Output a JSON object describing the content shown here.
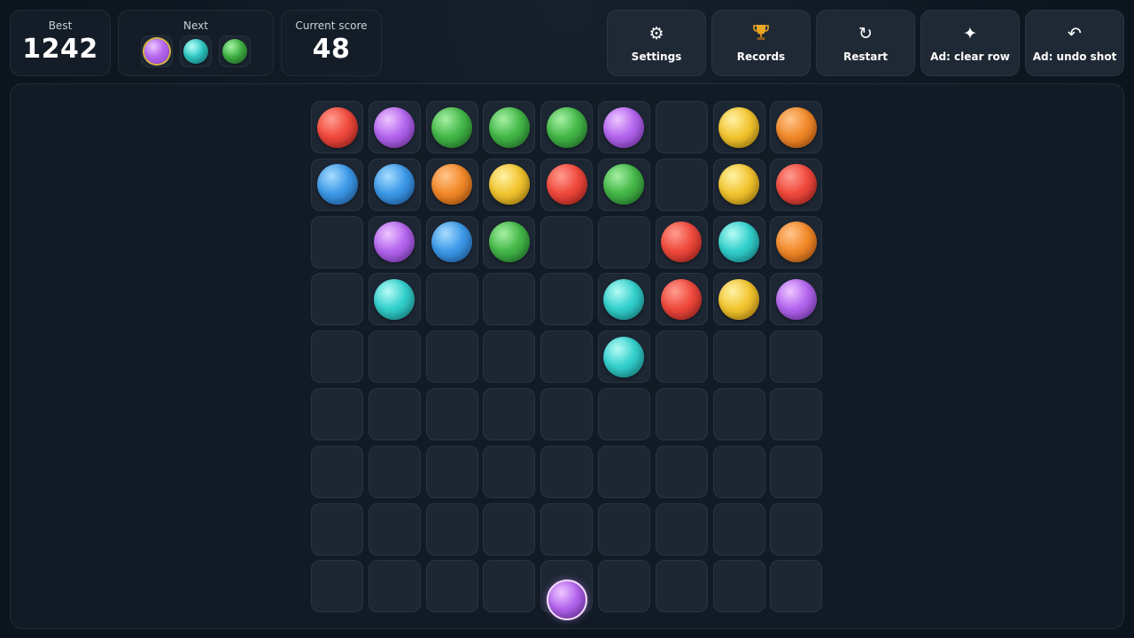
{
  "stats": {
    "best": {
      "label": "Best",
      "value": "1242"
    },
    "next": {
      "label": "Next",
      "balls": [
        "purple",
        "cyan",
        "green"
      ]
    },
    "score": {
      "label": "Current score",
      "value": "48"
    }
  },
  "toolbar": {
    "settings": {
      "label": "Settings",
      "icon": "gear-icon"
    },
    "records": {
      "label": "Records",
      "icon": "trophy-icon"
    },
    "restart": {
      "label": "Restart",
      "icon": "restart-icon"
    },
    "clear_row": {
      "label": "Ad: clear row",
      "icon": "sparkle-icon"
    },
    "undo_shot": {
      "label": "Ad: undo shot",
      "icon": "undo-icon"
    }
  },
  "board": {
    "rows": 9,
    "cols": 9,
    "cells": [
      [
        "red",
        "purple",
        "green",
        "green",
        "green",
        "purple",
        "",
        "yellow",
        "orange"
      ],
      [
        "blue",
        "blue",
        "orange",
        "yellow",
        "red",
        "green",
        "",
        "yellow",
        "red"
      ],
      [
        "",
        "purple",
        "blue",
        "green",
        "",
        "",
        "red",
        "cyan",
        "orange"
      ],
      [
        "",
        "cyan",
        "",
        "",
        "",
        "cyan",
        "red",
        "yellow",
        "purple"
      ],
      [
        "",
        "",
        "",
        "",
        "",
        "cyan",
        "",
        "",
        ""
      ],
      [
        "",
        "",
        "",
        "",
        "",
        "",
        "",
        "",
        ""
      ],
      [
        "",
        "",
        "",
        "",
        "",
        "",
        "",
        "",
        ""
      ],
      [
        "",
        "",
        "",
        "",
        "",
        "",
        "",
        "",
        ""
      ],
      [
        "",
        "",
        "",
        "",
        "",
        "",
        "",
        "",
        ""
      ]
    ]
  },
  "shooter": {
    "color": "purple"
  },
  "colors": {
    "red": "#f04a3d",
    "purple": "#b466ee",
    "green": "#44b848",
    "yellow": "#f2c531",
    "orange": "#f28a2a",
    "blue": "#3d9ae8",
    "cyan": "#33d0cc",
    "next_highlight": "#d9b34a"
  }
}
